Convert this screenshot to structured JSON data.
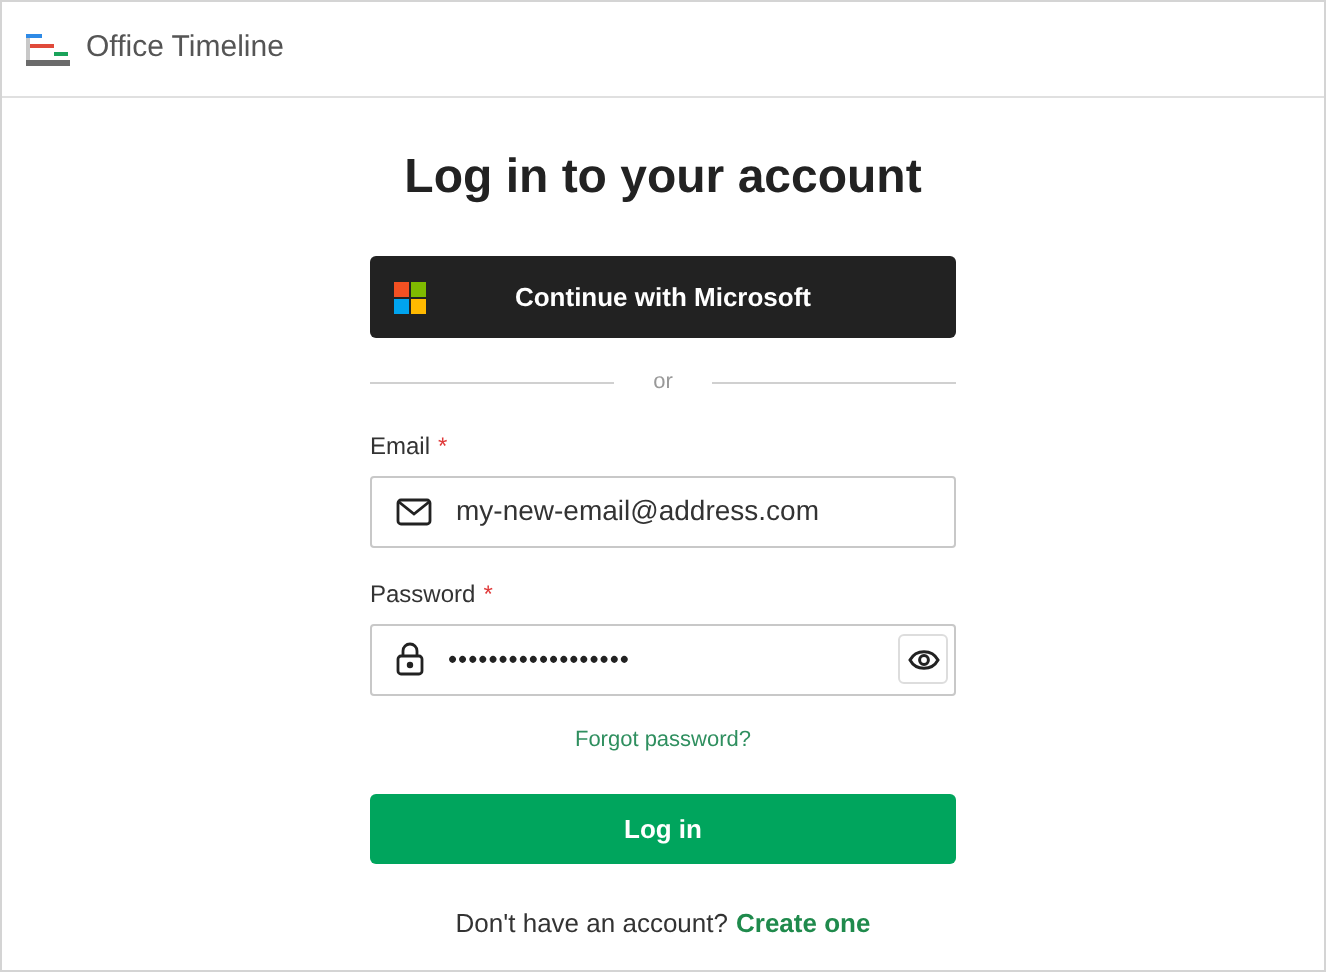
{
  "header": {
    "brand": "Office Timeline"
  },
  "title": "Log in to your account",
  "microsoft_button": "Continue with Microsoft",
  "divider_text": "or",
  "email": {
    "label": "Email",
    "required_mark": "*",
    "value": "my-new-email@address.com"
  },
  "password": {
    "label": "Password",
    "required_mark": "*",
    "value": "••••••••••••••••••"
  },
  "forgot_link": "Forgot password?",
  "login_button": "Log in",
  "signup": {
    "text": "Don't have an account?",
    "link": "Create one"
  }
}
